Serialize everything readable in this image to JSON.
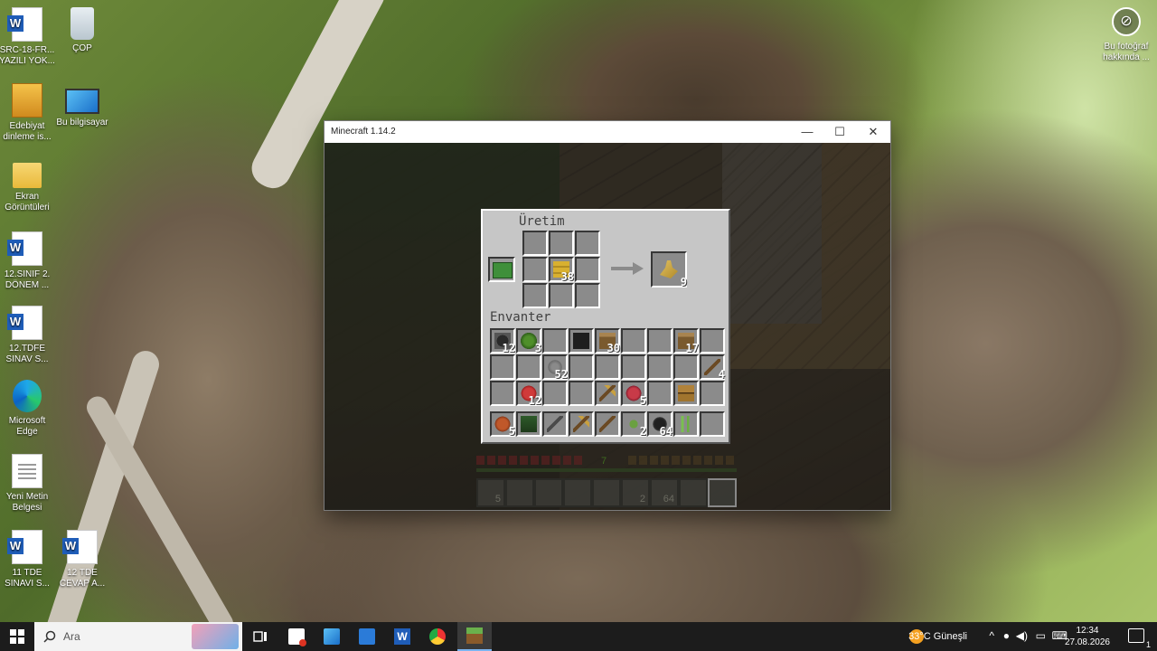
{
  "desktop": {
    "icons": [
      {
        "label": "SRC-18-FR...\nYAZILI YOK...",
        "type": "word"
      },
      {
        "label": "ÇOP",
        "type": "bin"
      },
      {
        "label": "Edebiyat\ndinleme is...",
        "type": "zip"
      },
      {
        "label": "Bu bilgisayar",
        "type": "pc"
      },
      {
        "label": "Ekran\nGörüntüleri",
        "type": "folder"
      },
      {
        "label": "12.SINIF 2.\nDÖNEM ...",
        "type": "word"
      },
      {
        "label": "12.TDFE\nSINAV S...",
        "type": "word"
      },
      {
        "label": "Microsoft\nEdge",
        "type": "edge"
      },
      {
        "label": "Yeni Metin\nBelgesi",
        "type": "txt"
      },
      {
        "label": "11 TDE\nSINAVI S...",
        "type": "word"
      },
      {
        "label": "12 TDE\nCEVAP A...",
        "type": "word"
      }
    ],
    "about_photo": "Bu fotoğraf\nhakkında ..."
  },
  "window": {
    "title": "Minecraft 1.14.2",
    "minimize": "—",
    "maximize": "☐",
    "close": "✕"
  },
  "inventory": {
    "crafting_title": "Üretim",
    "inventory_title": "Envanter",
    "crafting_grid": [
      "",
      "",
      "",
      "",
      "hay_bale",
      "",
      "",
      "",
      ""
    ],
    "crafting_counts": [
      "",
      "",
      "",
      "",
      "38",
      "",
      "",
      "",
      ""
    ],
    "result": {
      "item": "wheat",
      "count": "9"
    },
    "recipe_book": "recipe-book-icon",
    "main_rows": [
      [
        {
          "i": "coal_ore_helm",
          "c": "12"
        },
        {
          "i": "sapling",
          "c": "3"
        },
        {
          "i": "",
          "c": ""
        },
        {
          "i": "coal_block",
          "c": ""
        },
        {
          "i": "oak_log",
          "c": "30"
        },
        {
          "i": "",
          "c": ""
        },
        {
          "i": "",
          "c": ""
        },
        {
          "i": "oak_log",
          "c": "17"
        },
        {
          "i": "",
          "c": ""
        }
      ],
      [
        {
          "i": "",
          "c": ""
        },
        {
          "i": "",
          "c": ""
        },
        {
          "i": "gravel",
          "c": "52"
        },
        {
          "i": "",
          "c": ""
        },
        {
          "i": "",
          "c": ""
        },
        {
          "i": "",
          "c": ""
        },
        {
          "i": "",
          "c": ""
        },
        {
          "i": "",
          "c": ""
        },
        {
          "i": "stick",
          "c": "4"
        }
      ],
      [
        {
          "i": "",
          "c": ""
        },
        {
          "i": "raw_beef",
          "c": "12"
        },
        {
          "i": "",
          "c": ""
        },
        {
          "i": "",
          "c": ""
        },
        {
          "i": "pickaxe",
          "c": ""
        },
        {
          "i": "raw_mutton",
          "c": "5"
        },
        {
          "i": "",
          "c": ""
        },
        {
          "i": "chest",
          "c": ""
        },
        {
          "i": "",
          "c": ""
        }
      ]
    ],
    "hotbar": [
      {
        "i": "leather",
        "c": "5"
      },
      {
        "i": "spruce_sapling",
        "c": ""
      },
      {
        "i": "sword",
        "c": ""
      },
      {
        "i": "pickaxe",
        "c": ""
      },
      {
        "i": "axe",
        "c": ""
      },
      {
        "i": "seeds",
        "c": "2"
      },
      {
        "i": "coal",
        "c": "64"
      },
      {
        "i": "sugar_cane",
        "c": ""
      },
      {
        "i": "",
        "c": ""
      }
    ]
  },
  "game_hud": {
    "xp_level": "7",
    "hotbar_counts": [
      "5",
      "",
      "",
      "",
      "",
      "2",
      "64",
      "",
      ""
    ]
  },
  "taskbar": {
    "search_placeholder": "Ara",
    "weather": "33°C  Güneşli",
    "time": "12:34",
    "date": "27.08.2026",
    "notification_count": "1"
  }
}
